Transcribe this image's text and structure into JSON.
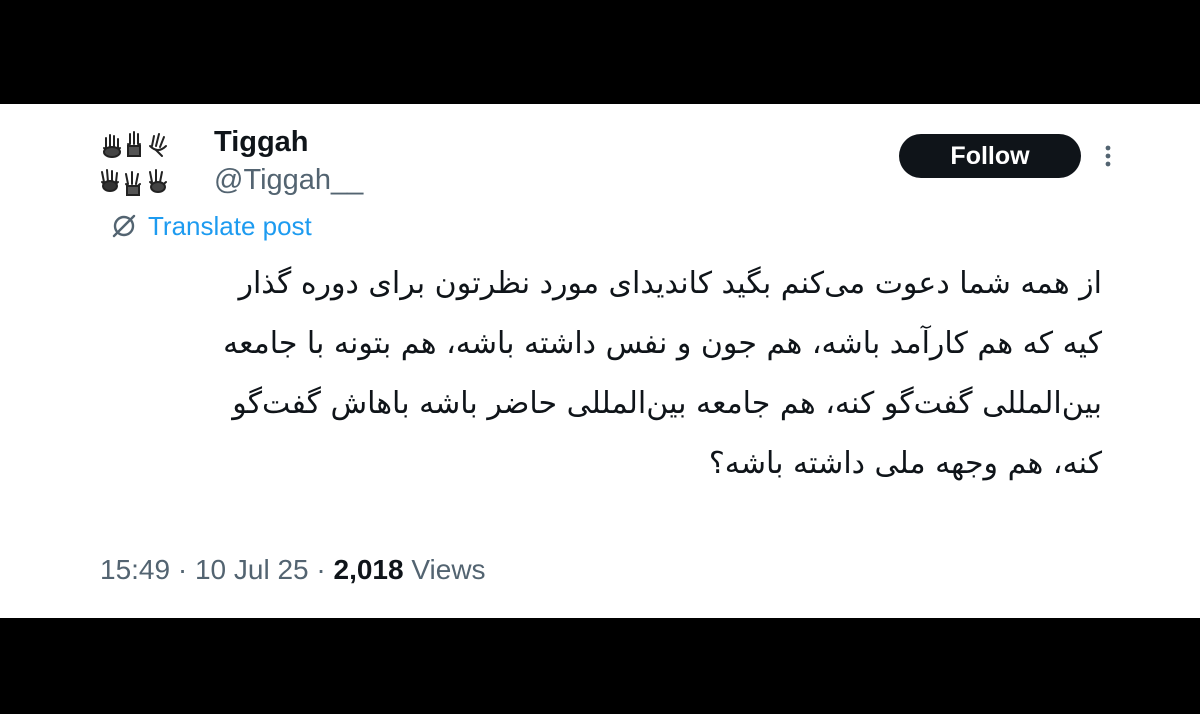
{
  "user": {
    "display_name": "Tiggah",
    "handle": "@Tiggah__",
    "avatar_icon": "hands-drawing-avatar-icon"
  },
  "follow_button": {
    "label": "Follow"
  },
  "more_menu": {
    "icon": "vertical-dots-icon"
  },
  "translate": {
    "label": "Translate post",
    "icon": "globe-slash-icon"
  },
  "tweet": {
    "lines": [
      "از همه شما دعوت می‌کنم بگید کاندیدای مورد نظرتون برای دوره گذار",
      "کیه که هم کارآمد باشه، هم جون و نفس داشته باشه، هم بتونه با جامعه",
      "بین‌المللی گفت‌گو کنه، هم جامعه بین‌المللی حاضر باشه باهاش گفت‌گو",
      "کنه، هم وجهه ملی داشته باشه؟"
    ]
  },
  "meta": {
    "time": "15:49",
    "separator": " · ",
    "date": "10 Jul 25",
    "views_count": "2,018",
    "views_label": "Views"
  },
  "colors": {
    "background": "#000000",
    "card": "#ffffff",
    "text_primary": "#0f1419",
    "text_secondary": "#536471",
    "link_blue": "#1d9bf0",
    "button_dark": "#0f1419"
  }
}
